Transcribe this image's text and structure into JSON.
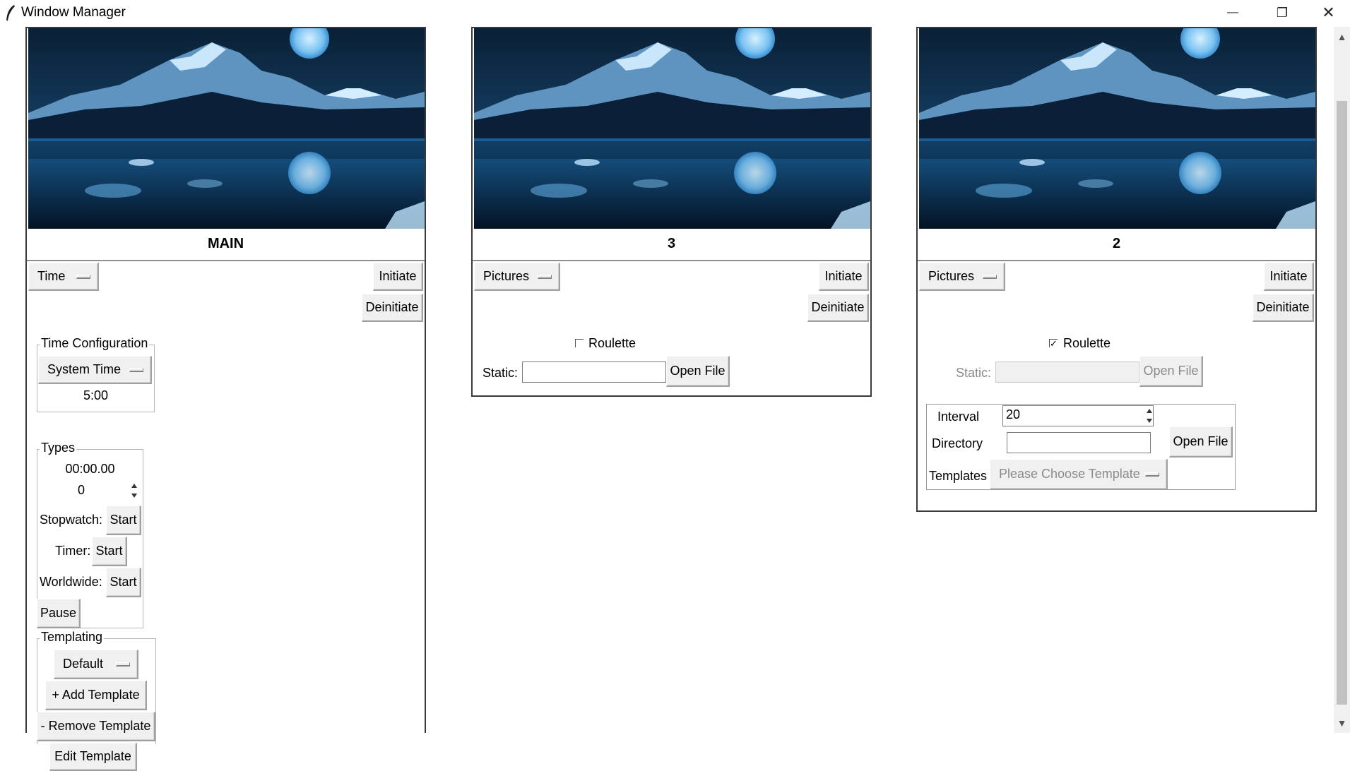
{
  "window": {
    "title": "Window Manager",
    "controls": {
      "minimize": "—",
      "restore": "❐",
      "close": "✕"
    }
  },
  "panels": [
    {
      "caption": "MAIN",
      "mode": "Time",
      "initiate": "Initiate",
      "deinitiate": "Deinitiate",
      "time_config": {
        "title": "Time Configuration",
        "source": "System Time",
        "value": "5:00"
      },
      "types": {
        "title": "Types",
        "elapsed": "00:00.00",
        "spin_value": "0",
        "stopwatch_label": "Stopwatch:",
        "timer_label": "Timer:",
        "worldwide_label": "Worldwide:",
        "start": "Start",
        "pause": "Pause"
      },
      "templating": {
        "title": "Templating",
        "selected": "Default",
        "add": "+ Add Template",
        "remove": "- Remove Template",
        "edit": "Edit Template"
      }
    },
    {
      "caption": "3",
      "mode": "Pictures",
      "initiate": "Initiate",
      "deinitiate": "Deinitiate",
      "roulette_label": "Roulette",
      "roulette_checked": false,
      "static_label": "Static:",
      "static_value": "",
      "open_file": "Open File"
    },
    {
      "caption": "2",
      "mode": "Pictures",
      "initiate": "Initiate",
      "deinitiate": "Deinitiate",
      "roulette_label": "Roulette",
      "roulette_checked": true,
      "static_label": "Static:",
      "static_value": "",
      "open_file": "Open File",
      "interval_label": "Interval",
      "interval_value": "20",
      "directory_label": "Directory",
      "directory_value": "",
      "directory_open": "Open File",
      "templates_label": "Templates",
      "templates_placeholder": "Please Choose Template"
    }
  ],
  "scrollbar": {
    "up": "▲",
    "down": "▼"
  },
  "colors": {
    "night_sky": "#0b2a4a",
    "moon": "#8fd0ff",
    "water": "#0a3a66"
  }
}
